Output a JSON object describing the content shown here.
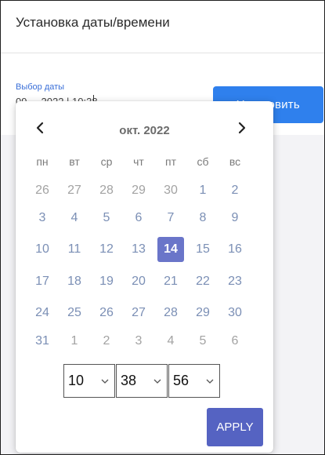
{
  "dialog": {
    "title": "Установка даты/времени"
  },
  "date_field": {
    "label": "Выбор даты",
    "value_partial": "09 . . 2022 | 10:38"
  },
  "set_button": {
    "label": "Установить",
    "color": "#2f80ed"
  },
  "datepicker": {
    "month_title": "окт. 2022",
    "prev_icon": "chevron-left-icon",
    "next_icon": "chevron-right-icon",
    "weekdays": [
      "пн",
      "вт",
      "ср",
      "чт",
      "пт",
      "сб",
      "вс"
    ],
    "weeks": [
      [
        "26",
        "27",
        "28",
        "29",
        "30",
        "1",
        "2"
      ],
      [
        "3",
        "4",
        "5",
        "6",
        "7",
        "8",
        "9"
      ],
      [
        "10",
        "11",
        "12",
        "13",
        "14",
        "15",
        "16"
      ],
      [
        "17",
        "18",
        "19",
        "20",
        "21",
        "22",
        "23"
      ],
      [
        "24",
        "25",
        "26",
        "27",
        "28",
        "29",
        "30"
      ],
      [
        "31",
        "1",
        "2",
        "3",
        "4",
        "5",
        "6"
      ]
    ],
    "selected_day": "14",
    "selected_color": "#6a75c9",
    "time": {
      "hours": "10",
      "minutes": "38",
      "seconds": "56"
    },
    "apply_label": "APPLY",
    "apply_color": "#5563c2"
  }
}
